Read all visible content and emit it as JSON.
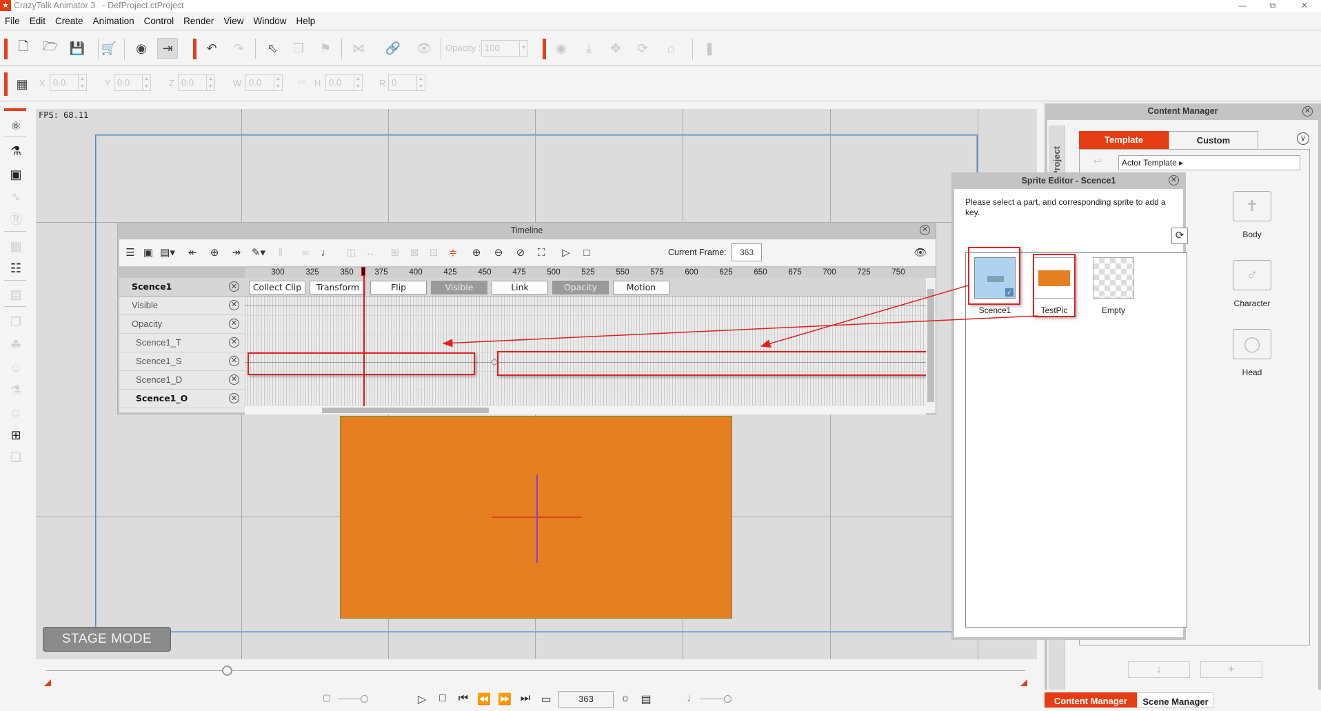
{
  "window": {
    "app_title": "CrazyTalk Animator 3   - DefProject.ctProject",
    "controls": [
      "minimize",
      "restore",
      "close"
    ]
  },
  "menu": [
    "File",
    "Edit",
    "Create",
    "Animation",
    "Control",
    "Render",
    "View",
    "Window",
    "Help"
  ],
  "toolbar": {
    "buttons": [
      {
        "icon": "new-file-icon",
        "enabled": true
      },
      {
        "icon": "open-folder-icon",
        "enabled": true
      },
      {
        "icon": "save-icon",
        "enabled": true
      },
      {
        "icon": "cart-icon",
        "enabled": true
      },
      {
        "icon": "preview-icon",
        "enabled": true
      },
      {
        "icon": "export-icon",
        "enabled": true,
        "active": true
      },
      {
        "icon": "undo-icon",
        "enabled": true
      },
      {
        "icon": "redo-icon",
        "enabled": false
      },
      {
        "icon": "select-arrow-icon",
        "enabled": true
      },
      {
        "icon": "duplicate-icon",
        "enabled": false
      },
      {
        "icon": "paint-bucket-icon",
        "enabled": false
      },
      {
        "icon": "flip-icon",
        "enabled": false
      },
      {
        "icon": "link-icon",
        "enabled": false
      },
      {
        "icon": "eye-icon",
        "enabled": false
      }
    ],
    "opacity_label": "Opacity :",
    "opacity_value": "100",
    "camera_buttons": [
      "camera-icon",
      "pan-down-icon",
      "move-icon",
      "rotate-icon",
      "home-icon",
      "align-icon"
    ]
  },
  "transform": {
    "fields": [
      {
        "label": "X",
        "value": "0.0"
      },
      {
        "label": "Y",
        "value": "0.0"
      },
      {
        "label": "Z",
        "value": "0.0"
      },
      {
        "label": "W",
        "value": "0.0"
      },
      {
        "label": "H",
        "value": "0.0"
      },
      {
        "label": "R",
        "value": "0"
      }
    ]
  },
  "stage": {
    "fps_text": "FPS:  68.11",
    "mode_label": "STAGE MODE",
    "object_color": "#e57f22"
  },
  "timeline": {
    "title": "Timeline",
    "current_frame_label": "Current Frame:",
    "current_frame": "363",
    "ruler_ticks": [
      "300",
      "325",
      "350",
      "375",
      "400",
      "425",
      "450",
      "475",
      "500",
      "525",
      "550",
      "575",
      "600",
      "625",
      "650",
      "675",
      "700",
      "725",
      "750"
    ],
    "tabs": [
      {
        "label": "Collect Clip",
        "on": false
      },
      {
        "label": "Transform",
        "on": false
      },
      {
        "label": "Flip",
        "on": false
      },
      {
        "label": "Visible",
        "on": true
      },
      {
        "label": "Link",
        "on": false
      },
      {
        "label": "Opacity",
        "on": true
      },
      {
        "label": "Motion",
        "on": false
      }
    ],
    "tracks": [
      {
        "name": "Scence1",
        "bold": true
      },
      {
        "name": "Visible",
        "bold": false
      },
      {
        "name": "Opacity",
        "bold": false
      },
      {
        "name": "Scence1_T",
        "bold": false
      },
      {
        "name": "Scence1_S",
        "bold": false
      },
      {
        "name": "Scence1_D",
        "bold": false
      },
      {
        "name": "Scence1_O",
        "bold": true
      }
    ]
  },
  "sprite_editor": {
    "title": "Sprite Editor - Scence1",
    "message": "Please select a part, and corresponding sprite to add a key.",
    "sprites": [
      {
        "name": "Scence1",
        "selected": true
      },
      {
        "name": "TestPic",
        "selected": false
      },
      {
        "name": "Empty",
        "selected": false
      }
    ]
  },
  "content_manager": {
    "title": "Content Manager",
    "side_tab": "Project",
    "tabs": [
      {
        "label": "Template",
        "active": true
      },
      {
        "label": "Custom",
        "active": false
      }
    ],
    "path": "Actor Template ▸",
    "folders": [
      "Body",
      "Character",
      "Head"
    ],
    "bottom_buttons": [
      "↓",
      "+"
    ]
  },
  "bottom_tabs": [
    {
      "label": "Content Manager",
      "active": true
    },
    {
      "label": "Scene Manager",
      "active": false
    }
  ],
  "playback": {
    "frame": "363"
  },
  "colors": {
    "accent": "#e0401a",
    "highlight": "#e02020"
  }
}
